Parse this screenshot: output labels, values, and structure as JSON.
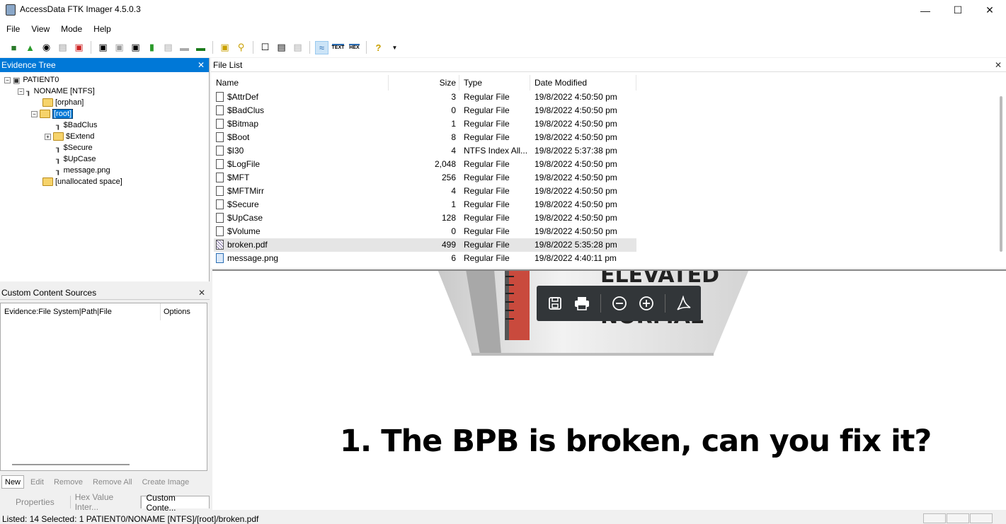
{
  "window": {
    "title": "AccessData FTK Imager 4.5.0.3"
  },
  "menu": [
    "File",
    "View",
    "Mode",
    "Help"
  ],
  "evidence_tree": {
    "title": "Evidence Tree",
    "nodes": [
      {
        "label": "PATIENT0"
      },
      {
        "label": "NONAME [NTFS]"
      },
      {
        "label": "[orphan]"
      },
      {
        "label": "[root]"
      },
      {
        "label": "$BadClus"
      },
      {
        "label": "$Extend"
      },
      {
        "label": "$Secure"
      },
      {
        "label": "$UpCase"
      },
      {
        "label": "message.png"
      },
      {
        "label": "[unallocated space]"
      }
    ]
  },
  "custom_sources": {
    "title": "Custom Content Sources",
    "col1": "Evidence:File System|Path|File",
    "col2": "Options",
    "buttons": [
      "New",
      "Edit",
      "Remove",
      "Remove All",
      "Create Image"
    ]
  },
  "bottom_tabs": [
    "Properties",
    "Hex Value Inter...",
    "Custom Conte..."
  ],
  "file_list": {
    "title": "File List",
    "headers": [
      "Name",
      "Size",
      "Type",
      "Date Modified"
    ],
    "rows": [
      {
        "name": "$AttrDef",
        "size": "3",
        "type": "Regular File",
        "date": "19/8/2022 4:50:50 pm"
      },
      {
        "name": "$BadClus",
        "size": "0",
        "type": "Regular File",
        "date": "19/8/2022 4:50:50 pm"
      },
      {
        "name": "$Bitmap",
        "size": "1",
        "type": "Regular File",
        "date": "19/8/2022 4:50:50 pm"
      },
      {
        "name": "$Boot",
        "size": "8",
        "type": "Regular File",
        "date": "19/8/2022 4:50:50 pm"
      },
      {
        "name": "$I30",
        "size": "4",
        "type": "NTFS Index All...",
        "date": "19/8/2022 5:37:38 pm"
      },
      {
        "name": "$LogFile",
        "size": "2,048",
        "type": "Regular File",
        "date": "19/8/2022 4:50:50 pm"
      },
      {
        "name": "$MFT",
        "size": "256",
        "type": "Regular File",
        "date": "19/8/2022 4:50:50 pm"
      },
      {
        "name": "$MFTMirr",
        "size": "4",
        "type": "Regular File",
        "date": "19/8/2022 4:50:50 pm"
      },
      {
        "name": "$Secure",
        "size": "1",
        "type": "Regular File",
        "date": "19/8/2022 4:50:50 pm"
      },
      {
        "name": "$UpCase",
        "size": "128",
        "type": "Regular File",
        "date": "19/8/2022 4:50:50 pm"
      },
      {
        "name": "$Volume",
        "size": "0",
        "type": "Regular File",
        "date": "19/8/2022 4:50:50 pm"
      },
      {
        "name": "broken.pdf",
        "size": "499",
        "type": "Regular File",
        "date": "19/8/2022 5:35:28 pm"
      },
      {
        "name": "message.png",
        "size": "6",
        "type": "Regular File",
        "date": "19/8/2022 4:40:11 pm"
      }
    ]
  },
  "viewer": {
    "image_words": [
      "ELEVATED",
      "NORMAL"
    ],
    "pdf_text": "1. The BPB is broken, can you fix it?"
  },
  "status": {
    "text": "Listed: 14   Selected: 1   PATIENT0/NONAME [NTFS]/[root]/broken.pdf"
  }
}
